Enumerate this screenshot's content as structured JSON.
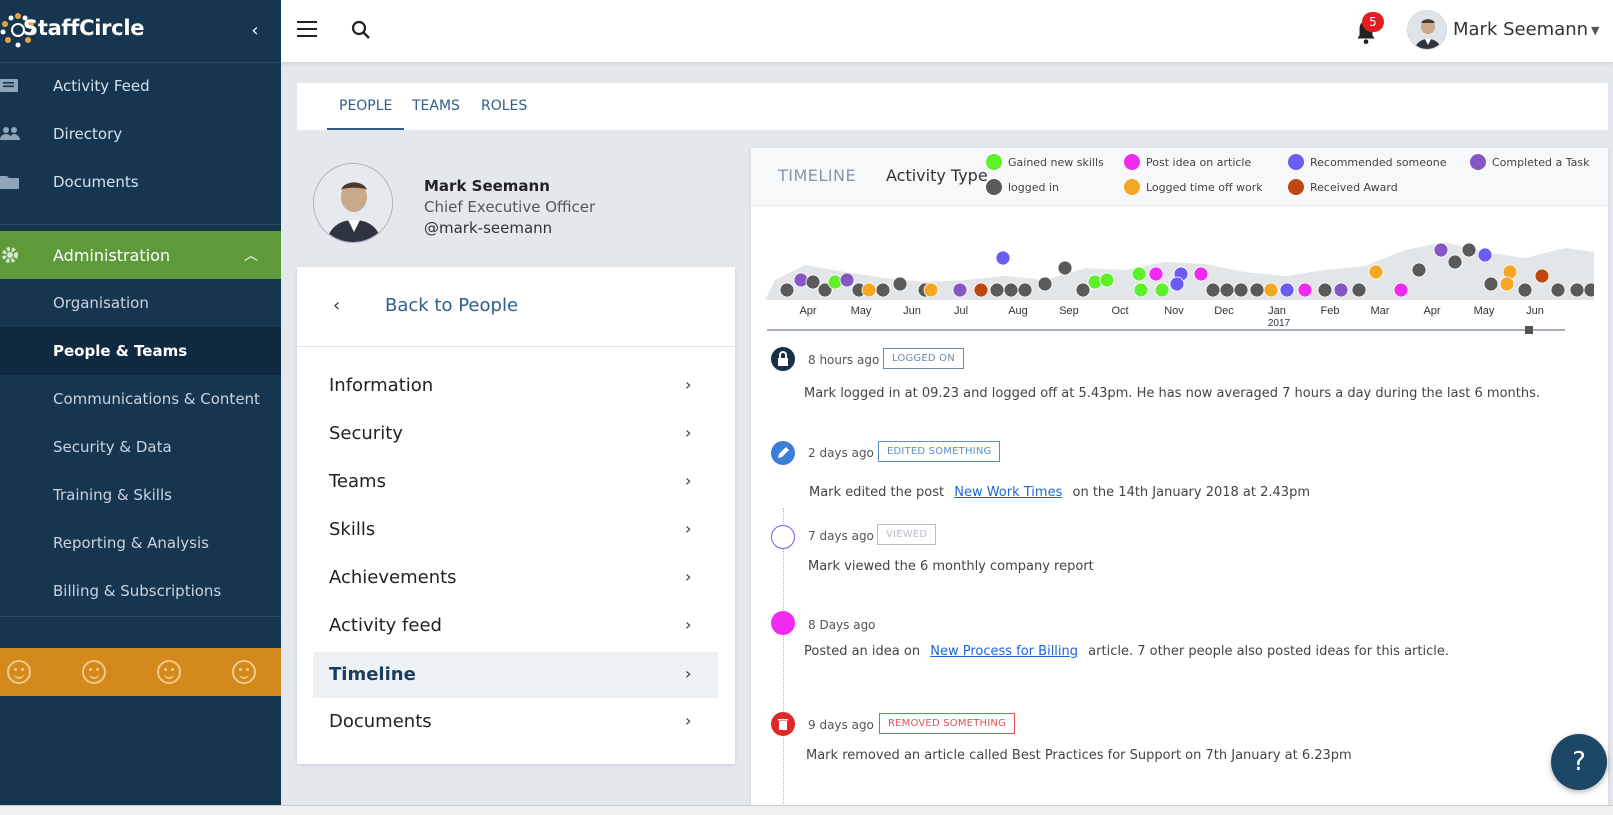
{
  "brand": {
    "name": "StaffCircle"
  },
  "sidebar": {
    "primary": [
      {
        "label": "Activity Feed",
        "icon": "feed-icon"
      },
      {
        "label": "Directory",
        "icon": "people-icon"
      },
      {
        "label": "Documents",
        "icon": "folder-icon"
      }
    ],
    "admin": {
      "label": "Administration",
      "icon": "gear-icon"
    },
    "admin_items": [
      {
        "label": "Organisation"
      },
      {
        "label": "People & Teams",
        "active": true
      },
      {
        "label": "Communications & Content"
      },
      {
        "label": "Security & Data"
      },
      {
        "label": "Training & Skills"
      },
      {
        "label": "Reporting & Analysis"
      },
      {
        "label": "Billing & Subscriptions"
      }
    ],
    "mood_icons": [
      "smile-icon",
      "smile-icon",
      "smile-icon",
      "smile-icon"
    ]
  },
  "topbar": {
    "notifications": "5",
    "user_name": "Mark Seemann"
  },
  "tabs": [
    {
      "label": "PEOPLE",
      "active": true
    },
    {
      "label": "TEAMS"
    },
    {
      "label": "ROLES"
    }
  ],
  "profile": {
    "name": "Mark Seemann",
    "role": "Chief Executive Officer",
    "handle": "@mark-seemann"
  },
  "menu": {
    "back_label": "Back to People",
    "items": [
      {
        "label": "Information"
      },
      {
        "label": "Security"
      },
      {
        "label": "Teams"
      },
      {
        "label": "Skills"
      },
      {
        "label": "Achievements"
      },
      {
        "label": "Activity feed"
      },
      {
        "label": "Timeline",
        "active": true
      },
      {
        "label": "Documents"
      }
    ]
  },
  "timeline": {
    "title": "TIMELINE",
    "activity_type_label": "Activity Type",
    "legend": [
      {
        "label": "Gained new skills",
        "color": "#5ef02a"
      },
      {
        "label": "Post idea on article",
        "color": "#f02af0"
      },
      {
        "label": "Recommended someone",
        "color": "#6a5cf5"
      },
      {
        "label": "Completed a Task",
        "color": "#8657c4"
      },
      {
        "label": "logged in",
        "color": "#5a5a5a"
      },
      {
        "label": "Logged time off work",
        "color": "#f5a623"
      },
      {
        "label": "Received Award",
        "color": "#c0460f"
      }
    ],
    "axis_months": [
      "Apr",
      "May",
      "Jun",
      "Jul",
      "Aug",
      "Sep",
      "Oct",
      "Nov",
      "Dec",
      "Jan",
      "Feb",
      "Mar",
      "Apr",
      "May",
      "Jun"
    ],
    "axis_year": "2017",
    "events": [
      {
        "time": "8 hours ago",
        "tag": "LOGGED ON",
        "tag_color": "#6c8aa8",
        "icon": "lock-icon",
        "text": "Mark logged in at 09.23 and logged off at 5.43pm. He has now averaged 7 hours a day during the last 6 months."
      },
      {
        "time": "2 days ago",
        "tag": "EDITED SOMETHING",
        "tag_color": "#5b8fc6",
        "icon": "pencil-icon",
        "text_before": "Mark edited the post",
        "link": "New Work Times",
        "text_after": "on the 14th January 2018 at 2.43pm"
      },
      {
        "time": "7 days ago",
        "tag": "VIEWED",
        "tag_color": "#b7bec6",
        "icon": "eye-icon",
        "text": "Mark viewed the 6 monthly company report"
      },
      {
        "time": "8 Days ago",
        "icon": "idea-icon",
        "text_before": "Posted an idea on",
        "link": "New Process for Billing",
        "text_after": "article. 7 other people also posted ideas for this article."
      },
      {
        "time": "9 days ago",
        "tag": "REMOVED SOMETHING",
        "tag_color": "#e0525a",
        "icon": "trash-icon",
        "text": "Mark removed an article called  Best Practices for Support  on 7th January at 6.23pm"
      }
    ]
  },
  "help": {
    "label": "?"
  }
}
